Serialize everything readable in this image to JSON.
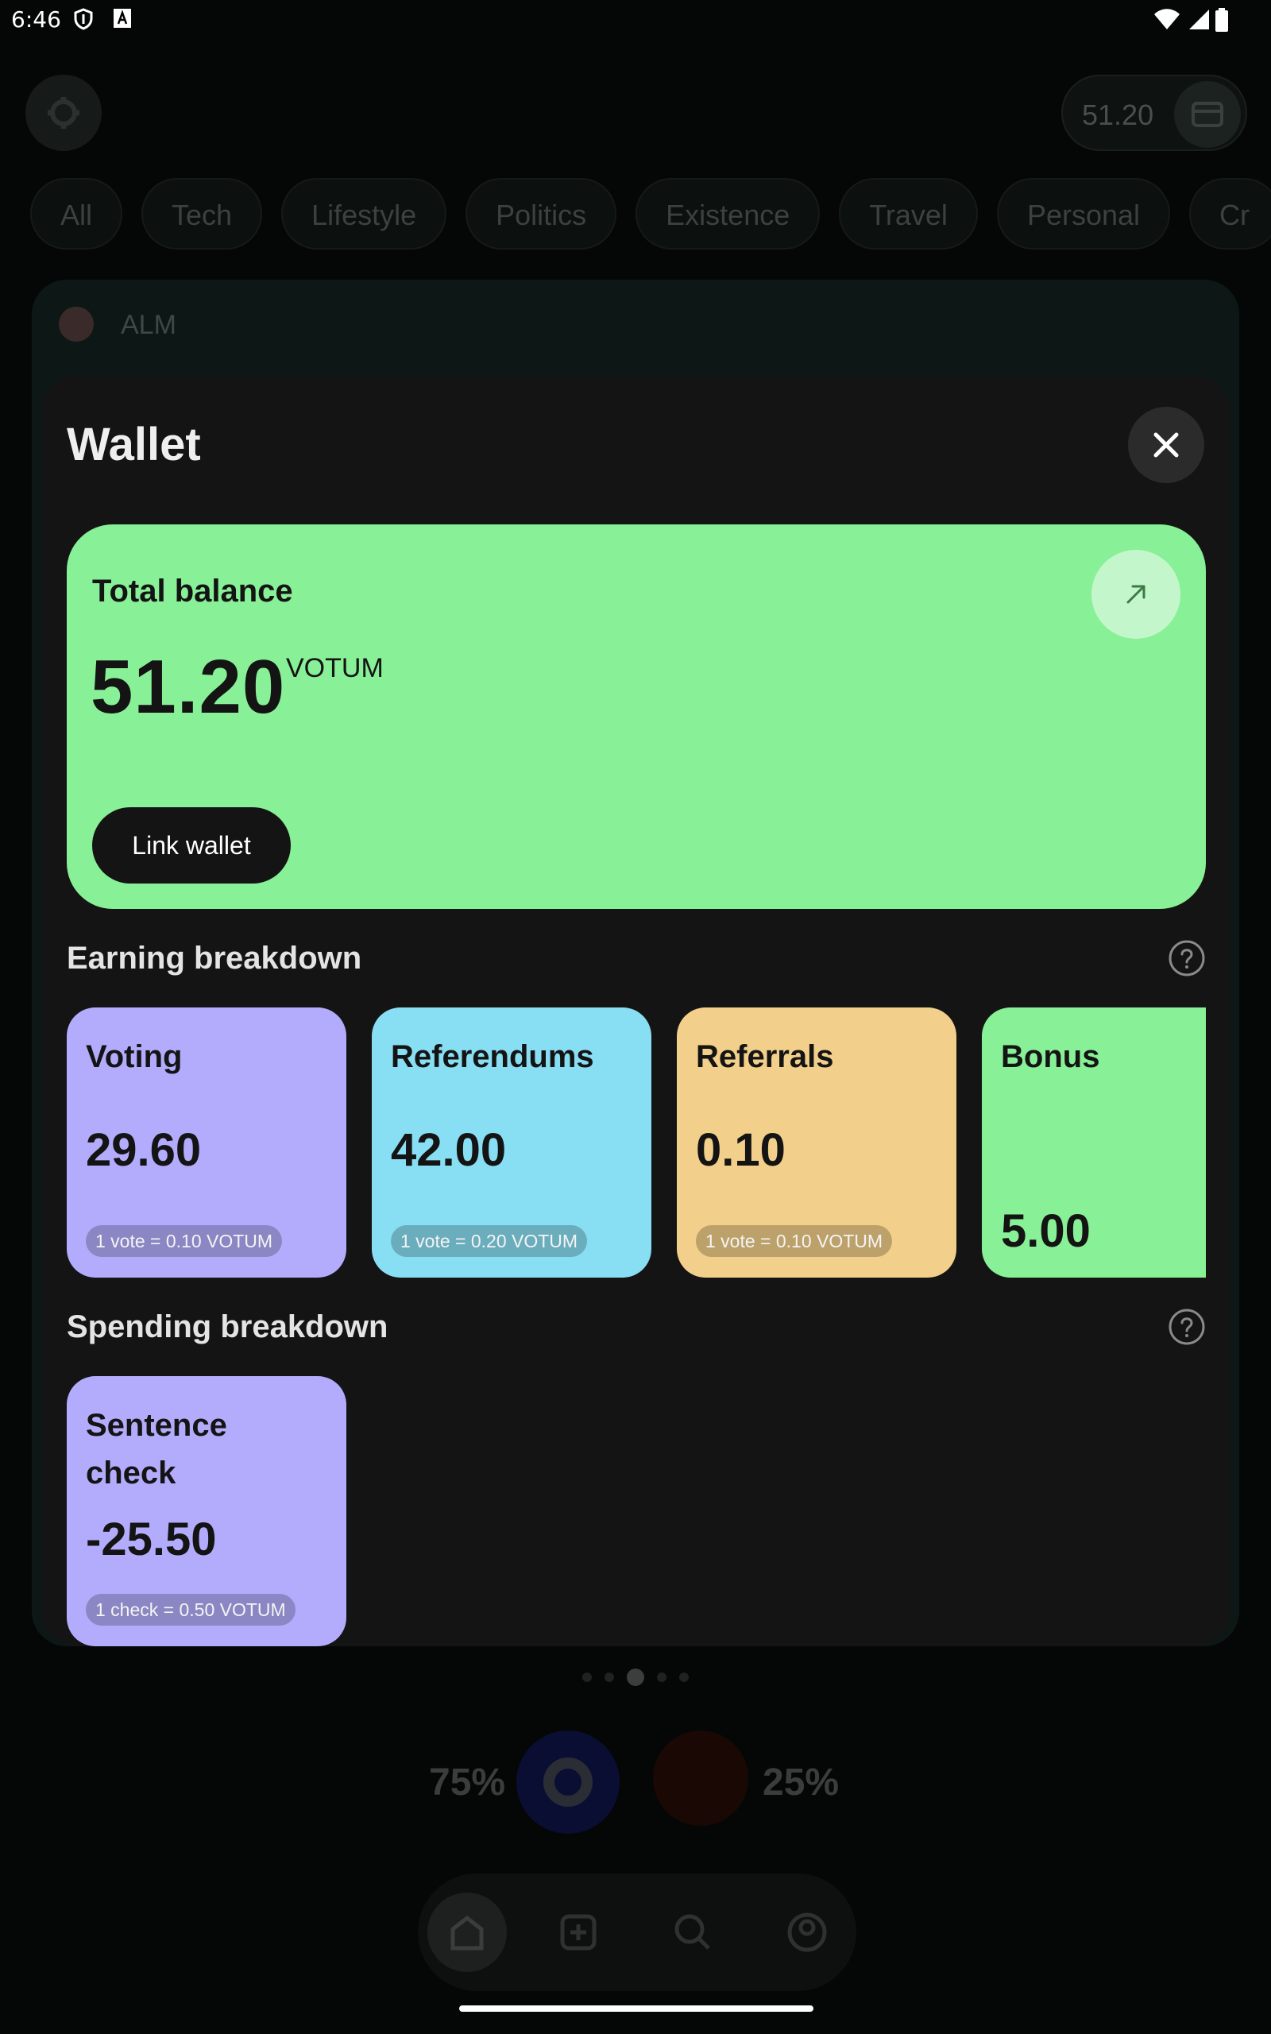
{
  "status_bar": {
    "time": "6:46"
  },
  "background": {
    "balance": "51.20",
    "categories": [
      "All",
      "Tech",
      "Lifestyle",
      "Politics",
      "Existence",
      "Travel",
      "Personal",
      "Cr"
    ],
    "post_author": "ALM",
    "vote_left_percent": "75%",
    "vote_right_percent": "25%"
  },
  "wallet": {
    "title": "Wallet",
    "balance_label": "Total balance",
    "balance_value": "51.20",
    "balance_unit": "VOTUM",
    "link_wallet_label": "Link wallet",
    "earning_title": "Earning breakdown",
    "earning": [
      {
        "label": "Voting",
        "value": "29.60",
        "rate": "1 vote = 0.10 VOTUM",
        "color": "#b3acfc"
      },
      {
        "label": "Referendums",
        "value": "42.00",
        "rate": "1 vote = 0.20 VOTUM",
        "color": "#88def2"
      },
      {
        "label": "Referrals",
        "value": "0.10",
        "rate": "1 vote = 0.10 VOTUM",
        "color": "#f2cf8a"
      },
      {
        "label": "Bonus",
        "value": "5.00",
        "color": "#88f096"
      }
    ],
    "spending_title": "Spending breakdown",
    "spending": [
      {
        "label": "Sentence check",
        "value": "-25.50",
        "rate": "1 check = 0.50 VOTUM",
        "color": "#b3acfc"
      }
    ]
  }
}
